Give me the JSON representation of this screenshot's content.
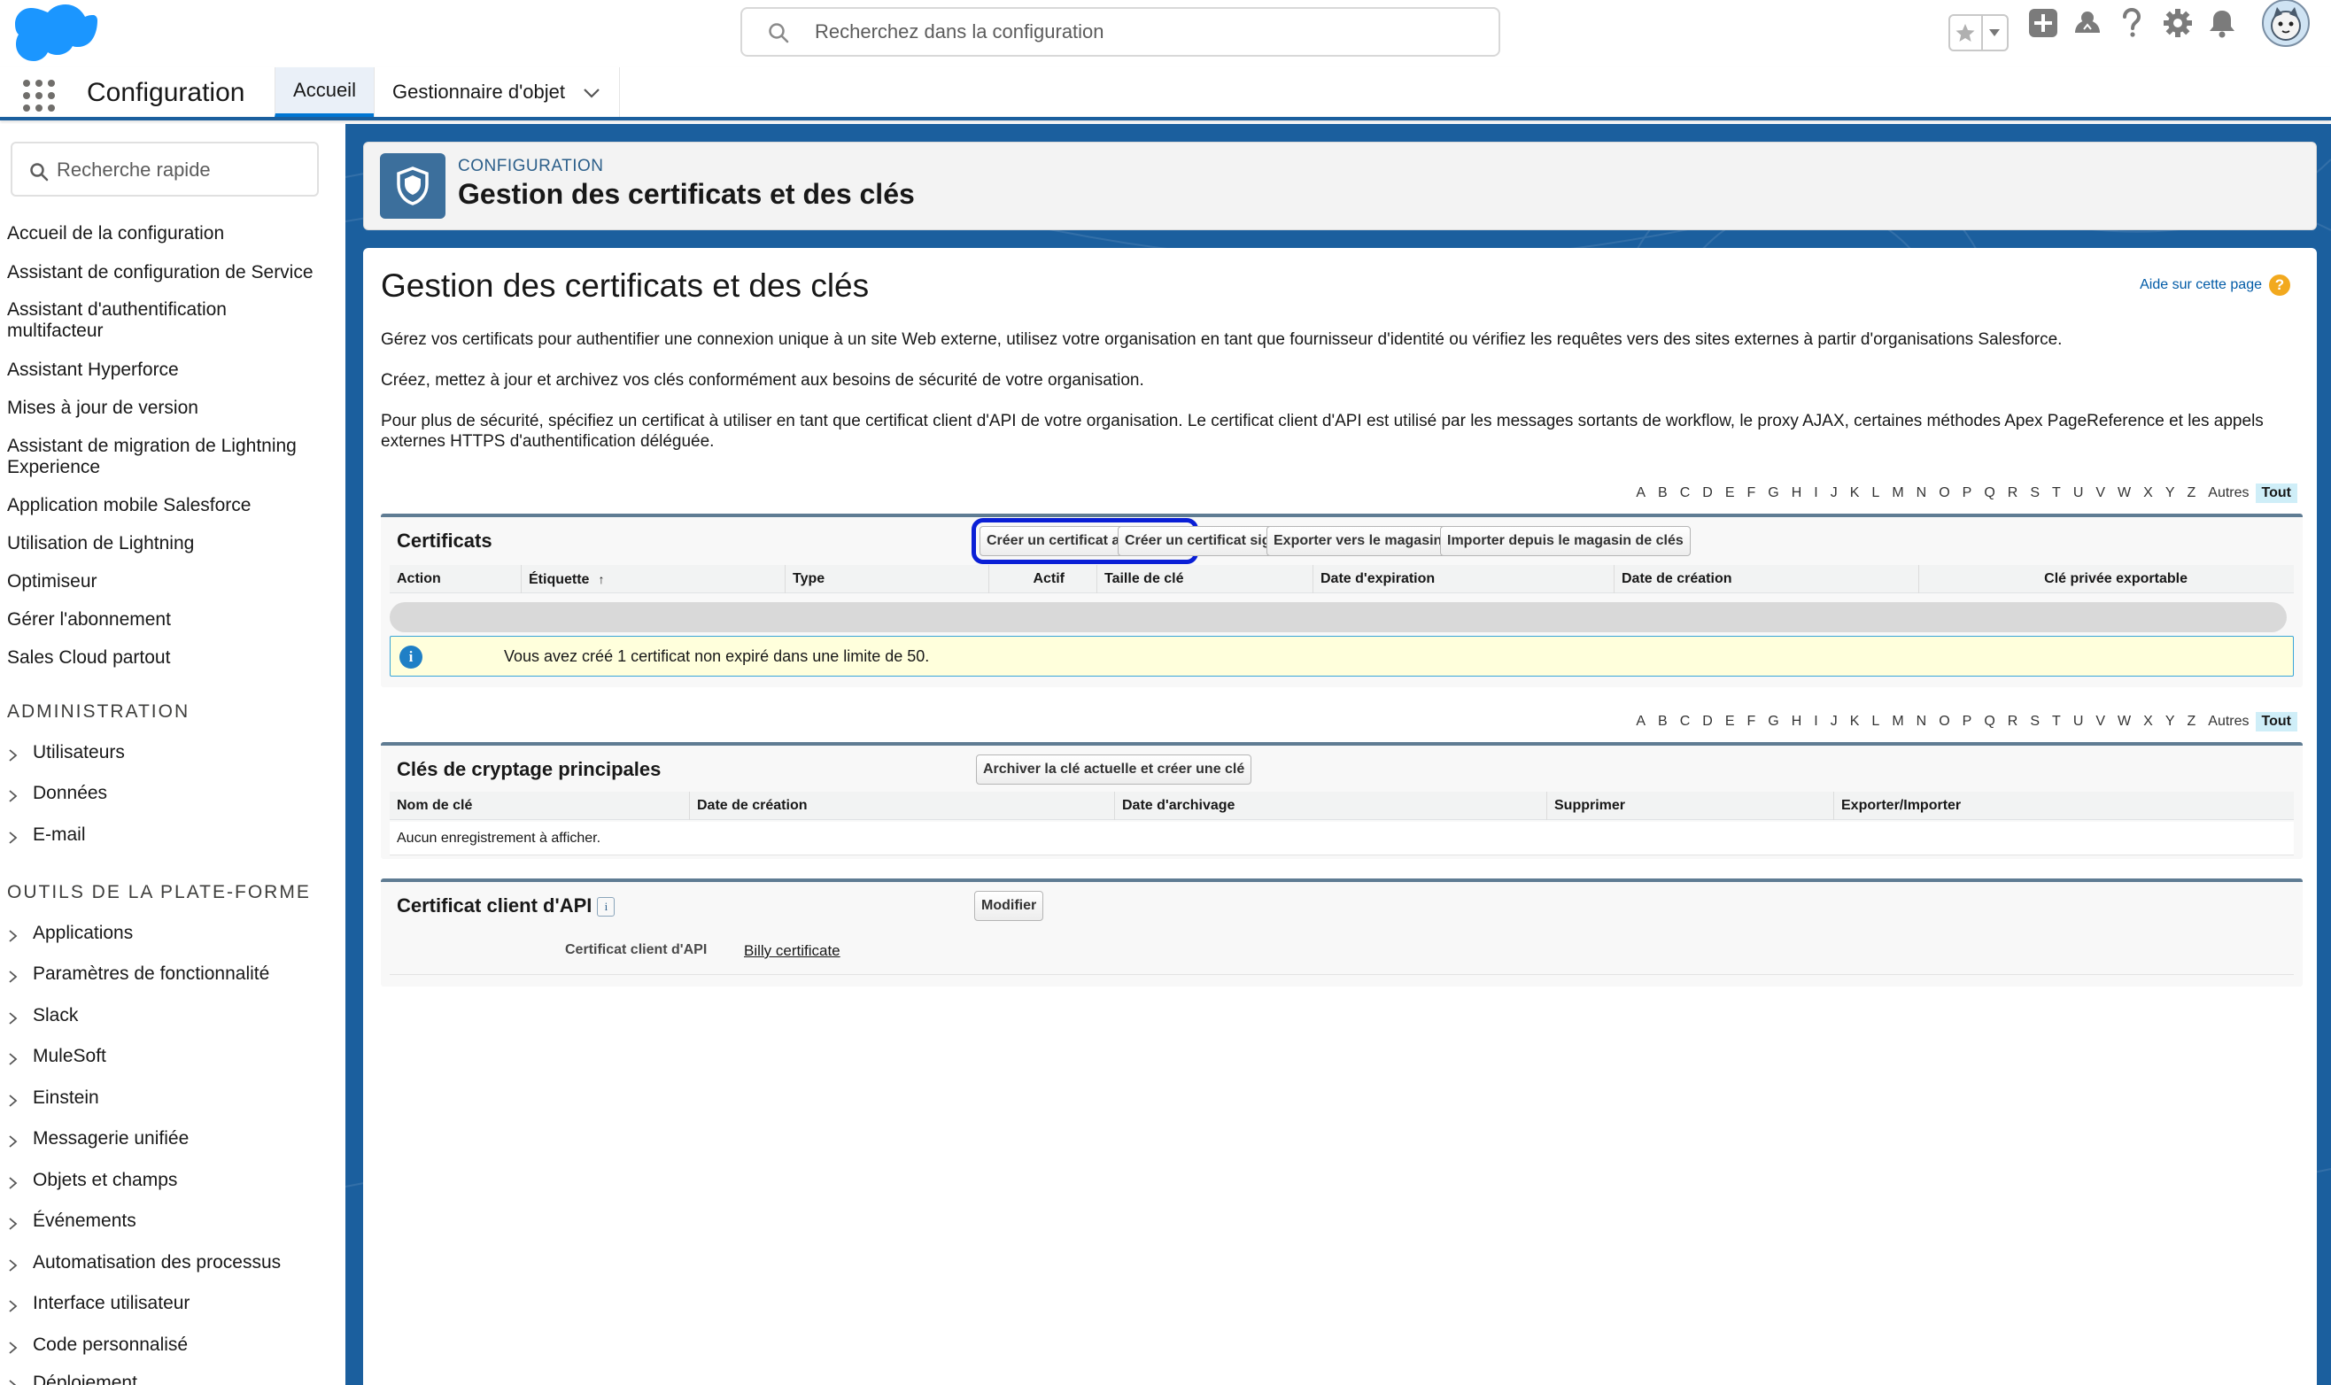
{
  "header": {
    "search_placeholder": "Recherchez dans la configuration",
    "icons": [
      "star-icon",
      "chevron-down-icon",
      "add-icon",
      "trailhead-icon",
      "help-icon",
      "gear-icon",
      "bell-icon",
      "avatar"
    ]
  },
  "app_nav": {
    "app_name": "Configuration",
    "tabs": [
      {
        "label": "Accueil",
        "active": true
      },
      {
        "label": "Gestionnaire d'objet",
        "active": false
      }
    ]
  },
  "sidebar": {
    "quickfind_placeholder": "Recherche rapide",
    "links": [
      "Accueil de la configuration",
      "Assistant de configuration de Service",
      "Assistant d'authentification multifacteur",
      "Assistant Hyperforce",
      "Mises à jour de version",
      "Assistant de migration de Lightning Experience",
      "Application mobile Salesforce",
      "Utilisation de Lightning",
      "Optimiseur",
      "Gérer l'abonnement",
      "Sales Cloud partout"
    ],
    "section_admin": "ADMINISTRATION",
    "admin_items": [
      "Utilisateurs",
      "Données",
      "E-mail"
    ],
    "section_platform": "OUTILS DE LA PLATE-FORME",
    "platform_items": [
      "Applications",
      "Paramètres de fonctionnalité",
      "Slack",
      "MuleSoft",
      "Einstein",
      "Messagerie unifiée",
      "Objets et champs",
      "Événements",
      "Automatisation des processus",
      "Interface utilisateur",
      "Code personnalisé",
      "Déploiement"
    ]
  },
  "page_header": {
    "eyebrow": "CONFIGURATION",
    "title": "Gestion des certificats et des clés"
  },
  "main": {
    "title": "Gestion des certificats et des clés",
    "help_link": "Aide sur cette page",
    "paragraphs": [
      "Gérez vos certificats pour authentifier une connexion unique à un site Web externe, utilisez votre organisation en tant que fournisseur d'identité ou vérifiez les requêtes vers des sites externes à partir d'organisations Salesforce.",
      "Créez, mettez à jour et archivez vos clés conformément aux besoins de sécurité de votre organisation.",
      "Pour plus de sécurité, spécifiez un certificat à utiliser en tant que certificat client d'API de votre organisation. Le certificat client d'API est utilisé par les messages sortants de workflow, le proxy AJAX, certaines méthodes Apex PageReference et les appels externes HTTPS d'authentification déléguée."
    ],
    "alphabet": [
      "A",
      "B",
      "C",
      "D",
      "E",
      "F",
      "G",
      "H",
      "I",
      "J",
      "K",
      "L",
      "M",
      "N",
      "O",
      "P",
      "Q",
      "R",
      "S",
      "T",
      "U",
      "V",
      "W",
      "X",
      "Y",
      "Z",
      "Autres",
      "Tout"
    ],
    "alphabet_selected": "Tout"
  },
  "certificates": {
    "title": "Certificats",
    "buttons": [
      "Créer un certificat auto-signé",
      "Créer un certificat signé par AC",
      "Exporter vers le magasin de clés",
      "Importer depuis le magasin de clés"
    ],
    "columns": [
      "Action",
      "Étiquette",
      "Type",
      "Actif",
      "Taille de clé",
      "Date d'expiration",
      "Date de création",
      "Clé privée exportable"
    ],
    "sort_indicator": "↑",
    "info": "Vous avez créé 1 certificat non expiré dans une limite de 50."
  },
  "master_keys": {
    "title": "Clés de cryptage principales",
    "button": "Archiver la clé actuelle et créer une clé",
    "columns": [
      "Nom de clé",
      "Date de création",
      "Date d'archivage",
      "Supprimer",
      "Exporter/Importer"
    ],
    "empty": "Aucun enregistrement à afficher."
  },
  "api_client_cert": {
    "title": "Certificat client d'API",
    "info_glyph": "i",
    "button": "Modifier",
    "field_label": "Certificat client d'API",
    "field_value": "Billy certificate"
  },
  "colors": {
    "brand_blue": "#1b5f9e",
    "link_blue": "#015ba7",
    "highlight_ring": "#0a1fd6",
    "info_bg": "#ffffdc"
  }
}
